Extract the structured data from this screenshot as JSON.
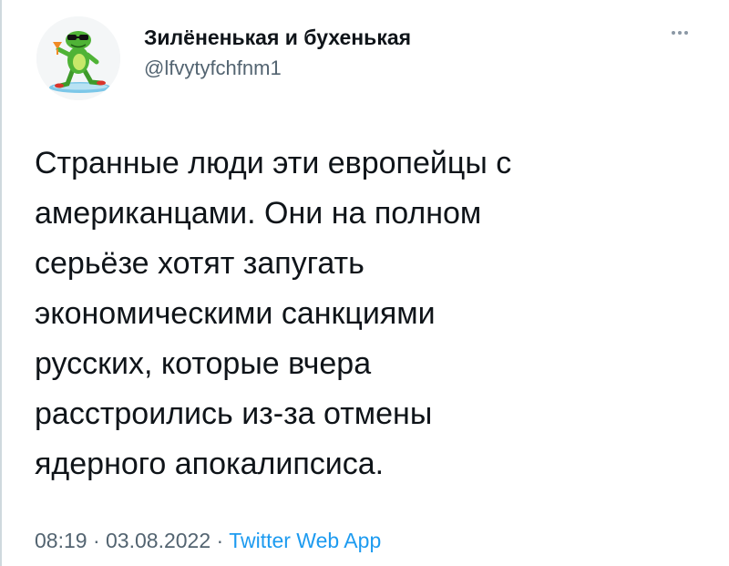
{
  "tweet": {
    "author": {
      "display_name": "Зилёненькая и бухенькая",
      "handle": "@lfvytyfchfnm1"
    },
    "text_lines": [
      "Странные люди эти европейцы с",
      "американцами. Они на полном",
      "серьёзе хотят запугать",
      "экономическими санкциями",
      "русских, которые вчера",
      "расстроились из-за отмены",
      "ядерного апокалипсиса."
    ],
    "meta": {
      "time": "08:19",
      "separator": "·",
      "date": "03.08.2022",
      "source": "Twitter Web App"
    }
  },
  "icons": {
    "more": "more-icon",
    "avatar": "frog-with-sunglasses-on-surfboard"
  },
  "colors": {
    "text": "#0f1419",
    "secondary": "#536471",
    "link": "#1d9bf0",
    "border": "#cfd9de"
  }
}
